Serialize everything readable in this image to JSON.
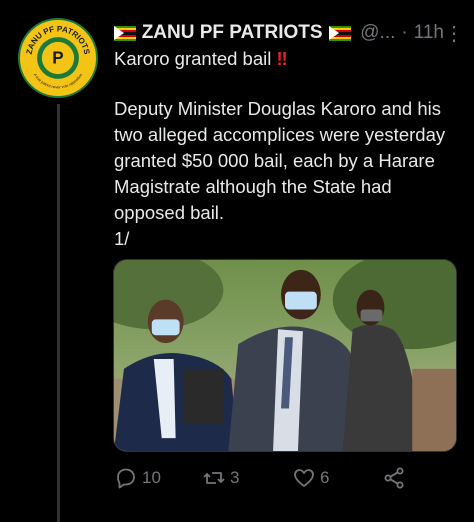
{
  "tweet": {
    "account_name": "ZANU PF PATRIOTS",
    "handle": "@...",
    "separator": "·",
    "time": "11h",
    "more_icon": "more-vertical-icon",
    "avatar": {
      "ring_text_top": "ZANU PF PATRIOTS",
      "ring_text_bottom": "A true patriot never vote opposition",
      "center_letter": "P"
    },
    "headline": "Karoro granted bail",
    "headline_emoji": "‼",
    "body": "Deputy Minister Douglas Karoro and his two alleged accomplices were yesterday granted $50 000 bail, each by a Harare Magistrate although the State had opposed bail.",
    "thread_marker": "1/"
  },
  "actions": {
    "reply_count": "10",
    "retweet_count": "3",
    "like_count": "6"
  },
  "colors": {
    "background": "#000000",
    "text": "#e7e9ea",
    "muted": "#71767b",
    "avatar_yellow": "#f3c316",
    "avatar_green": "#1a7a3a",
    "flag_green": "#319208",
    "flag_yellow": "#ffd200",
    "flag_red": "#d40000"
  }
}
